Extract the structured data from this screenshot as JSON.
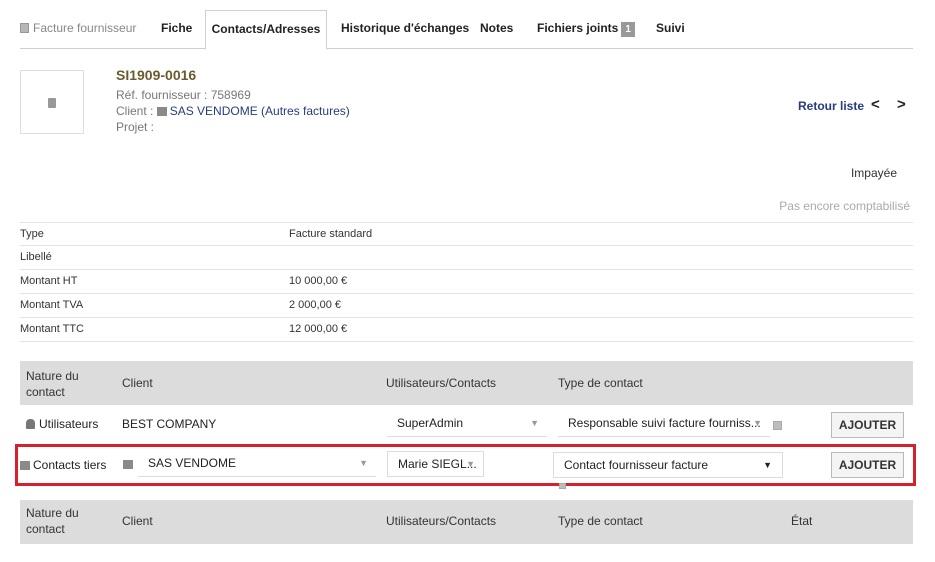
{
  "tabs": [
    {
      "label": "Facture fournisseur"
    },
    {
      "label": "Fiche"
    },
    {
      "label": "Contacts/Adresses"
    },
    {
      "label": "Historique d'échanges"
    },
    {
      "label": "Notes"
    },
    {
      "label": "Fichiers joints",
      "badge": "1"
    },
    {
      "label": "Suivi"
    }
  ],
  "header": {
    "ref": "SI1909-0016",
    "supplier_ref": "Réf. fournisseur : 758969",
    "client_label": "Client : ",
    "client_value": "SAS VENDOME (Autres factures)",
    "project": "Projet :",
    "back": "Retour liste",
    "prev": "<",
    "next": ">"
  },
  "status": {
    "payment": "Impayée",
    "accounting": "Pas encore comptabilisé"
  },
  "info": [
    {
      "label": "Type",
      "value": "Facture standard"
    },
    {
      "label": "Libellé",
      "value": ""
    },
    {
      "label": "Montant HT",
      "value": "10 000,00 €"
    },
    {
      "label": "Montant TVA",
      "value": "2 000,00 €"
    },
    {
      "label": "Montant TTC",
      "value": "12 000,00 €"
    }
  ],
  "contacts_header": {
    "nature": "Nature du contact",
    "client": "Client",
    "users": "Utilisateurs/Contacts",
    "type": "Type de contact"
  },
  "row_users": {
    "nature": "Utilisateurs",
    "client": "BEST COMPANY",
    "user": "SuperAdmin",
    "type": "Responsable suivi facture fourniss...",
    "button": "AJOUTER"
  },
  "row_tiers": {
    "nature": "Contacts tiers",
    "client": "SAS VENDOME",
    "user": "Marie SIEGL...",
    "type": "Contact fournisseur facture",
    "button": "AJOUTER"
  },
  "list_header": {
    "nature": "Nature du contact",
    "client": "Client",
    "users": "Utilisateurs/Contacts",
    "type": "Type de contact",
    "state": "État"
  },
  "colors": {
    "highlight": "#d6212c",
    "link": "#263c7e",
    "header_bg": "#dcdcdc"
  }
}
